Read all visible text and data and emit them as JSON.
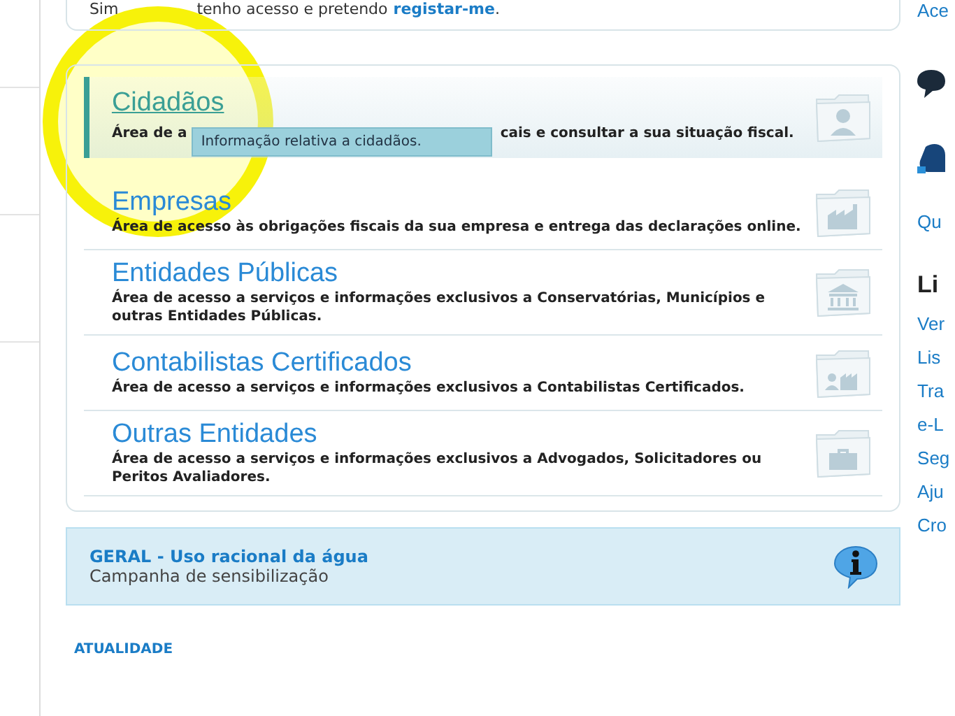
{
  "top_card": {
    "text_start": "Sim",
    "text_end": "tenho acesso e pretendo",
    "link": "registar-me",
    "tail": "."
  },
  "areas": [
    {
      "title": "Cidadãos",
      "kind": "person",
      "hovered": true,
      "desc_start": "Área de a",
      "desc_end": "cais e consultar a sua situação fiscal.",
      "tooltip": "Informação relativa a cidadãos."
    },
    {
      "title": "Empresas",
      "kind": "factory",
      "hovered": false,
      "desc": "Área de acesso às obrigações fiscais da sua empresa e entrega das declarações online."
    },
    {
      "title": "Entidades Públicas",
      "kind": "building",
      "hovered": false,
      "desc": "Área de acesso a serviços e informações exclusivos a Conservatórias, Municípios e outras Entidades Públicas."
    },
    {
      "title": "Contabilistas Certificados",
      "kind": "person-factory",
      "hovered": false,
      "desc": "Área de acesso a serviços e informações exclusivos a Contabilistas Certificados."
    },
    {
      "title": "Outras Entidades",
      "kind": "briefcase",
      "hovered": false,
      "desc": "Área de acesso a serviços e informações exclusivos a Advogados, Solicitadores ou Peritos Avaliadores."
    }
  ],
  "notice": {
    "title": "GERAL - Uso racional da água",
    "subtitle": "Campanha de sensibilização"
  },
  "section_heading": "ATUALIDADE",
  "right_column": {
    "top_link": "Ace",
    "link_below_icons": "Qu",
    "heading": "Li",
    "links": [
      "Ver",
      "Lis",
      "Tra",
      "e-L",
      "Seg",
      "Aju",
      "Cro"
    ]
  }
}
